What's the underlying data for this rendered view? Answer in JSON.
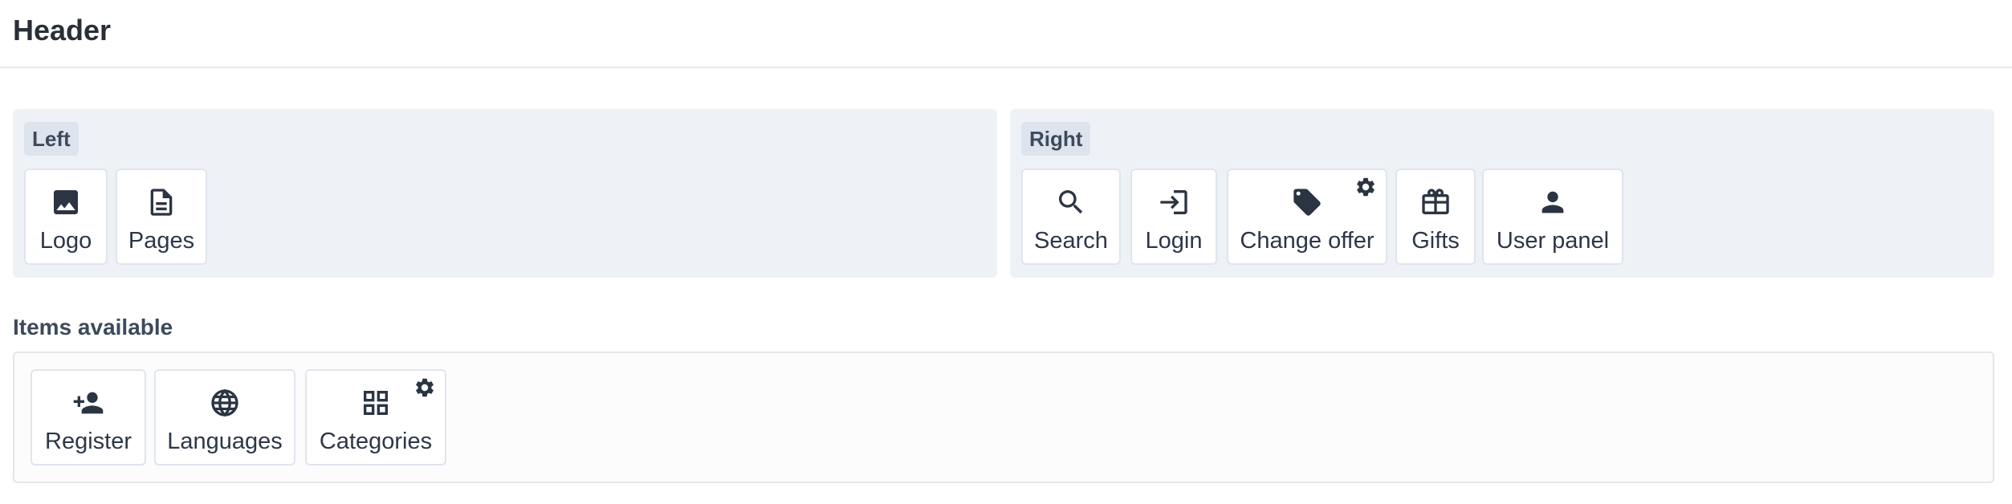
{
  "header": {
    "title": "Header"
  },
  "zones": {
    "left": {
      "label": "Left",
      "items": [
        {
          "label": "Logo",
          "icon": "image-icon"
        },
        {
          "label": "Pages",
          "icon": "document-icon"
        }
      ]
    },
    "right": {
      "label": "Right",
      "items": [
        {
          "label": "Search",
          "icon": "search-icon"
        },
        {
          "label": "Login",
          "icon": "login-icon"
        },
        {
          "label": "Change offer",
          "icon": "tag-icon",
          "has_settings": true
        },
        {
          "label": "Gifts",
          "icon": "gift-icon"
        },
        {
          "label": "User panel",
          "icon": "user-icon"
        }
      ]
    }
  },
  "available": {
    "title": "Items available",
    "items": [
      {
        "label": "Register",
        "icon": "user-add-icon"
      },
      {
        "label": "Languages",
        "icon": "globe-icon"
      },
      {
        "label": "Categories",
        "icon": "grid-icon",
        "has_settings": true
      }
    ]
  },
  "colors": {
    "zone_bg": "#eef2f7",
    "icon": "#2b3442",
    "text": "#2d3748"
  }
}
